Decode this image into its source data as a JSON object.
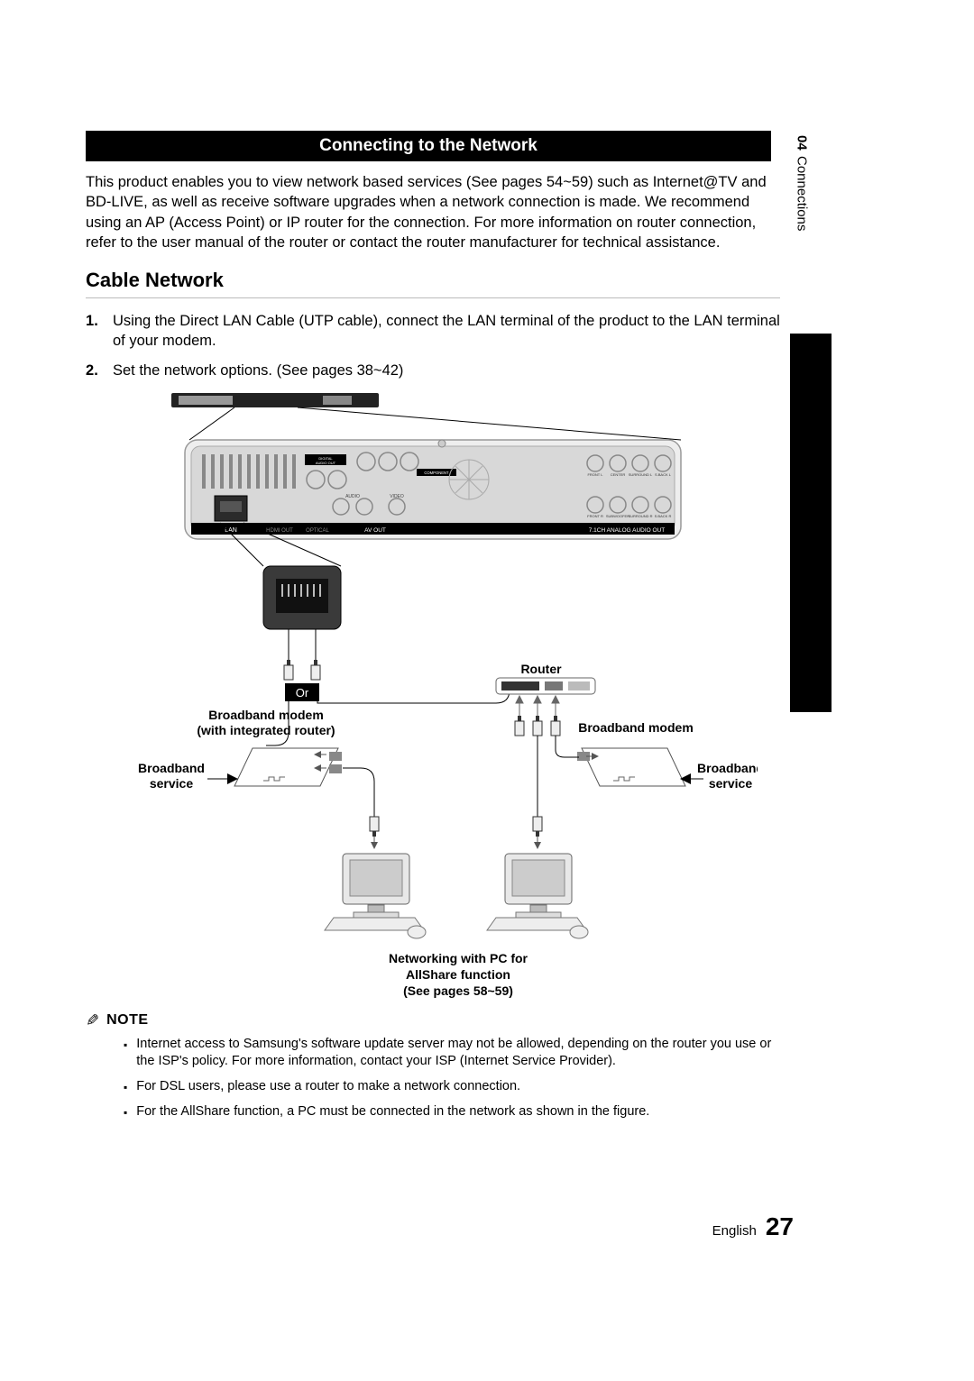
{
  "side_tab": {
    "number": "04",
    "title": "Connections"
  },
  "header": {
    "title": "Connecting to the Network"
  },
  "intro": "This product enables you to view network based services (See pages 54~59) such as Internet@TV and BD-LIVE, as well as receive software upgrades when a network connection is made. We recommend using an AP (Access Point) or IP router for the connection. For more information on router connection, refer to the user manual of the router or contact the router manufacturer for technical assistance.",
  "subhead": "Cable Network",
  "steps": [
    "Using the Direct LAN Cable (UTP cable), connect the LAN terminal of the product to the LAN terminal of your modem.",
    "Set the network options. (See pages 38~42)"
  ],
  "diagram": {
    "router": "Router",
    "or": "Or",
    "modem_left": "Broadband modem\n(with integrated router)",
    "modem_right": "Broadband modem",
    "service_left": "Broadband\nservice",
    "service_right": "Broadband\nservice",
    "pc_note": "Networking with PC for\nAllShare function\n(See pages 58~59)",
    "panel": {
      "lan": "LAN",
      "hdmi": "HDMI OUT",
      "optical": "OPTICAL",
      "digital_audio": "DIGITAL\nAUDIO OUT",
      "component": "COMPONENT\nOUT",
      "avout": "AV OUT",
      "analog71": "7.1CH ANALOG AUDIO OUT",
      "front_l": "FRONT L",
      "front_r": "FRONT R",
      "center": "CENTER",
      "sub": "SUBWOOFER",
      "surr_l": "SURROUND L",
      "surr_r": "SURROUND R",
      "sback_l": "S.BACK L",
      "sback_r": "S.BACK R",
      "audio": "AUDIO",
      "video": "VIDEO"
    }
  },
  "note_label": "NOTE",
  "notes": [
    "Internet access to Samsung's software update server may not be allowed, depending on the router you use or the ISP's policy. For more information, contact your ISP (Internet Service Provider).",
    "For DSL users, please use a router to make a network connection.",
    "For the AllShare function, a PC must be connected in the network as shown in the figure."
  ],
  "footer": {
    "language": "English",
    "page": "27"
  }
}
